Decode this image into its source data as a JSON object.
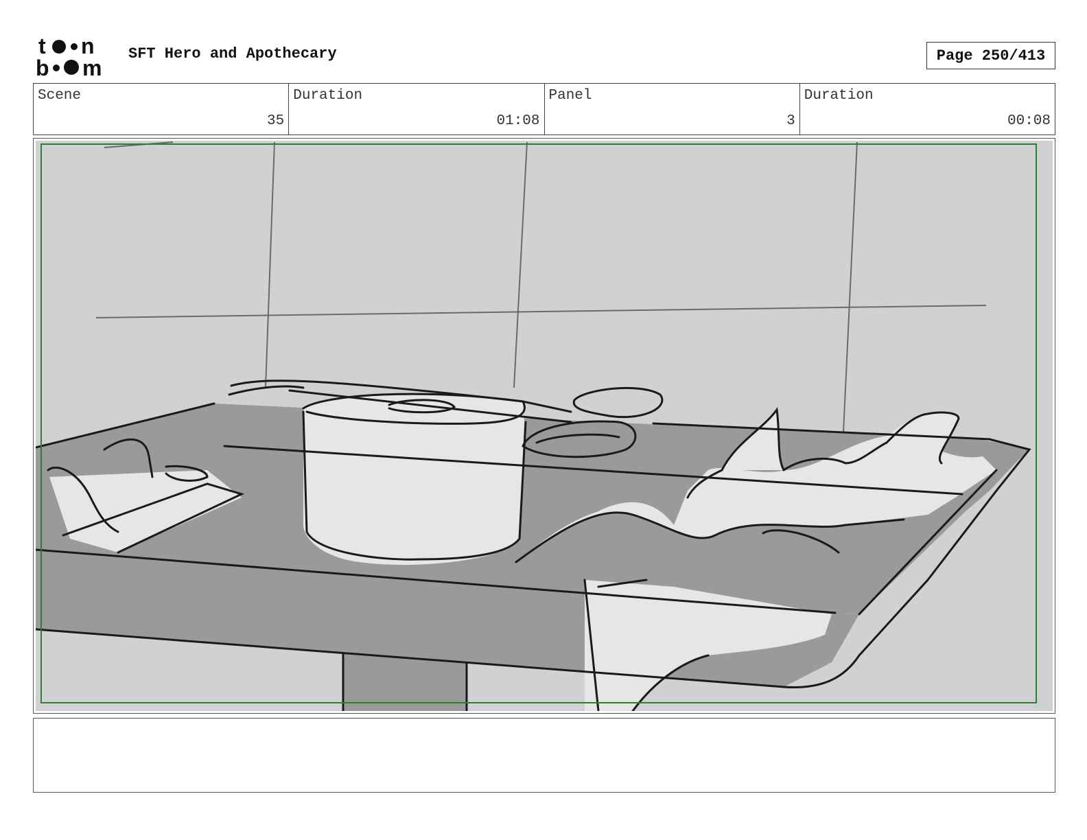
{
  "header": {
    "logo_alt": "toon boom",
    "project_title": "SFT Hero and Apothecary",
    "page_label": "Page 250/413"
  },
  "info": {
    "scene_label": "Scene",
    "scene_value": "35",
    "scene_duration_label": "Duration",
    "scene_duration_value": "01:08",
    "panel_label": "Panel",
    "panel_value": "3",
    "panel_duration_label": "Duration",
    "panel_duration_value": "00:08"
  },
  "notes": {
    "text": ""
  },
  "colors": {
    "safe_frame": "#2e7d32",
    "wall": "#d0d1d3",
    "table": "#9a9a9a",
    "pot": "#e6e6e6",
    "ink": "#1a1a1a"
  }
}
